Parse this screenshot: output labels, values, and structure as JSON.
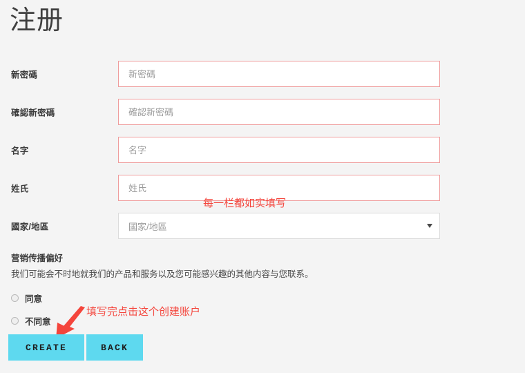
{
  "page": {
    "title": "注册",
    "background_color": "#f4f4f4"
  },
  "form": {
    "fields": [
      {
        "label": "新密碼",
        "placeholder": "新密碼",
        "value": "",
        "type": "password",
        "name": "new-password"
      },
      {
        "label": "確認新密碼",
        "placeholder": "確認新密碼",
        "value": "",
        "type": "password",
        "name": "confirm-new-password"
      },
      {
        "label": "名字",
        "placeholder": "名字",
        "value": "",
        "type": "text",
        "name": "first-name"
      },
      {
        "label": "姓氏",
        "placeholder": "姓氏",
        "value": "",
        "type": "text",
        "name": "last-name"
      }
    ],
    "country": {
      "label": "國家/地區",
      "selected": "國家/地區",
      "arrow_icon": "chevron-down-icon"
    },
    "input_border_color": "#ef9d9d",
    "select_border_color": "#dcdcdc"
  },
  "preferences": {
    "heading": "营销传播偏好",
    "description": "我们可能会不时地就我们的产品和服务以及您可能感兴趣的其他内容与您联系。",
    "options": [
      {
        "label": "同意",
        "selected": false
      },
      {
        "label": "不同意",
        "selected": false
      }
    ]
  },
  "buttons": {
    "create": "CREATE",
    "back": "BACK",
    "color": "#5ed9ef"
  },
  "annotations": {
    "fill_all": "每一栏都如实填写",
    "click_create": "填写完点击这个创建账户",
    "arrow_icon": "arrow-down-left-icon",
    "color": "#f4453c"
  }
}
